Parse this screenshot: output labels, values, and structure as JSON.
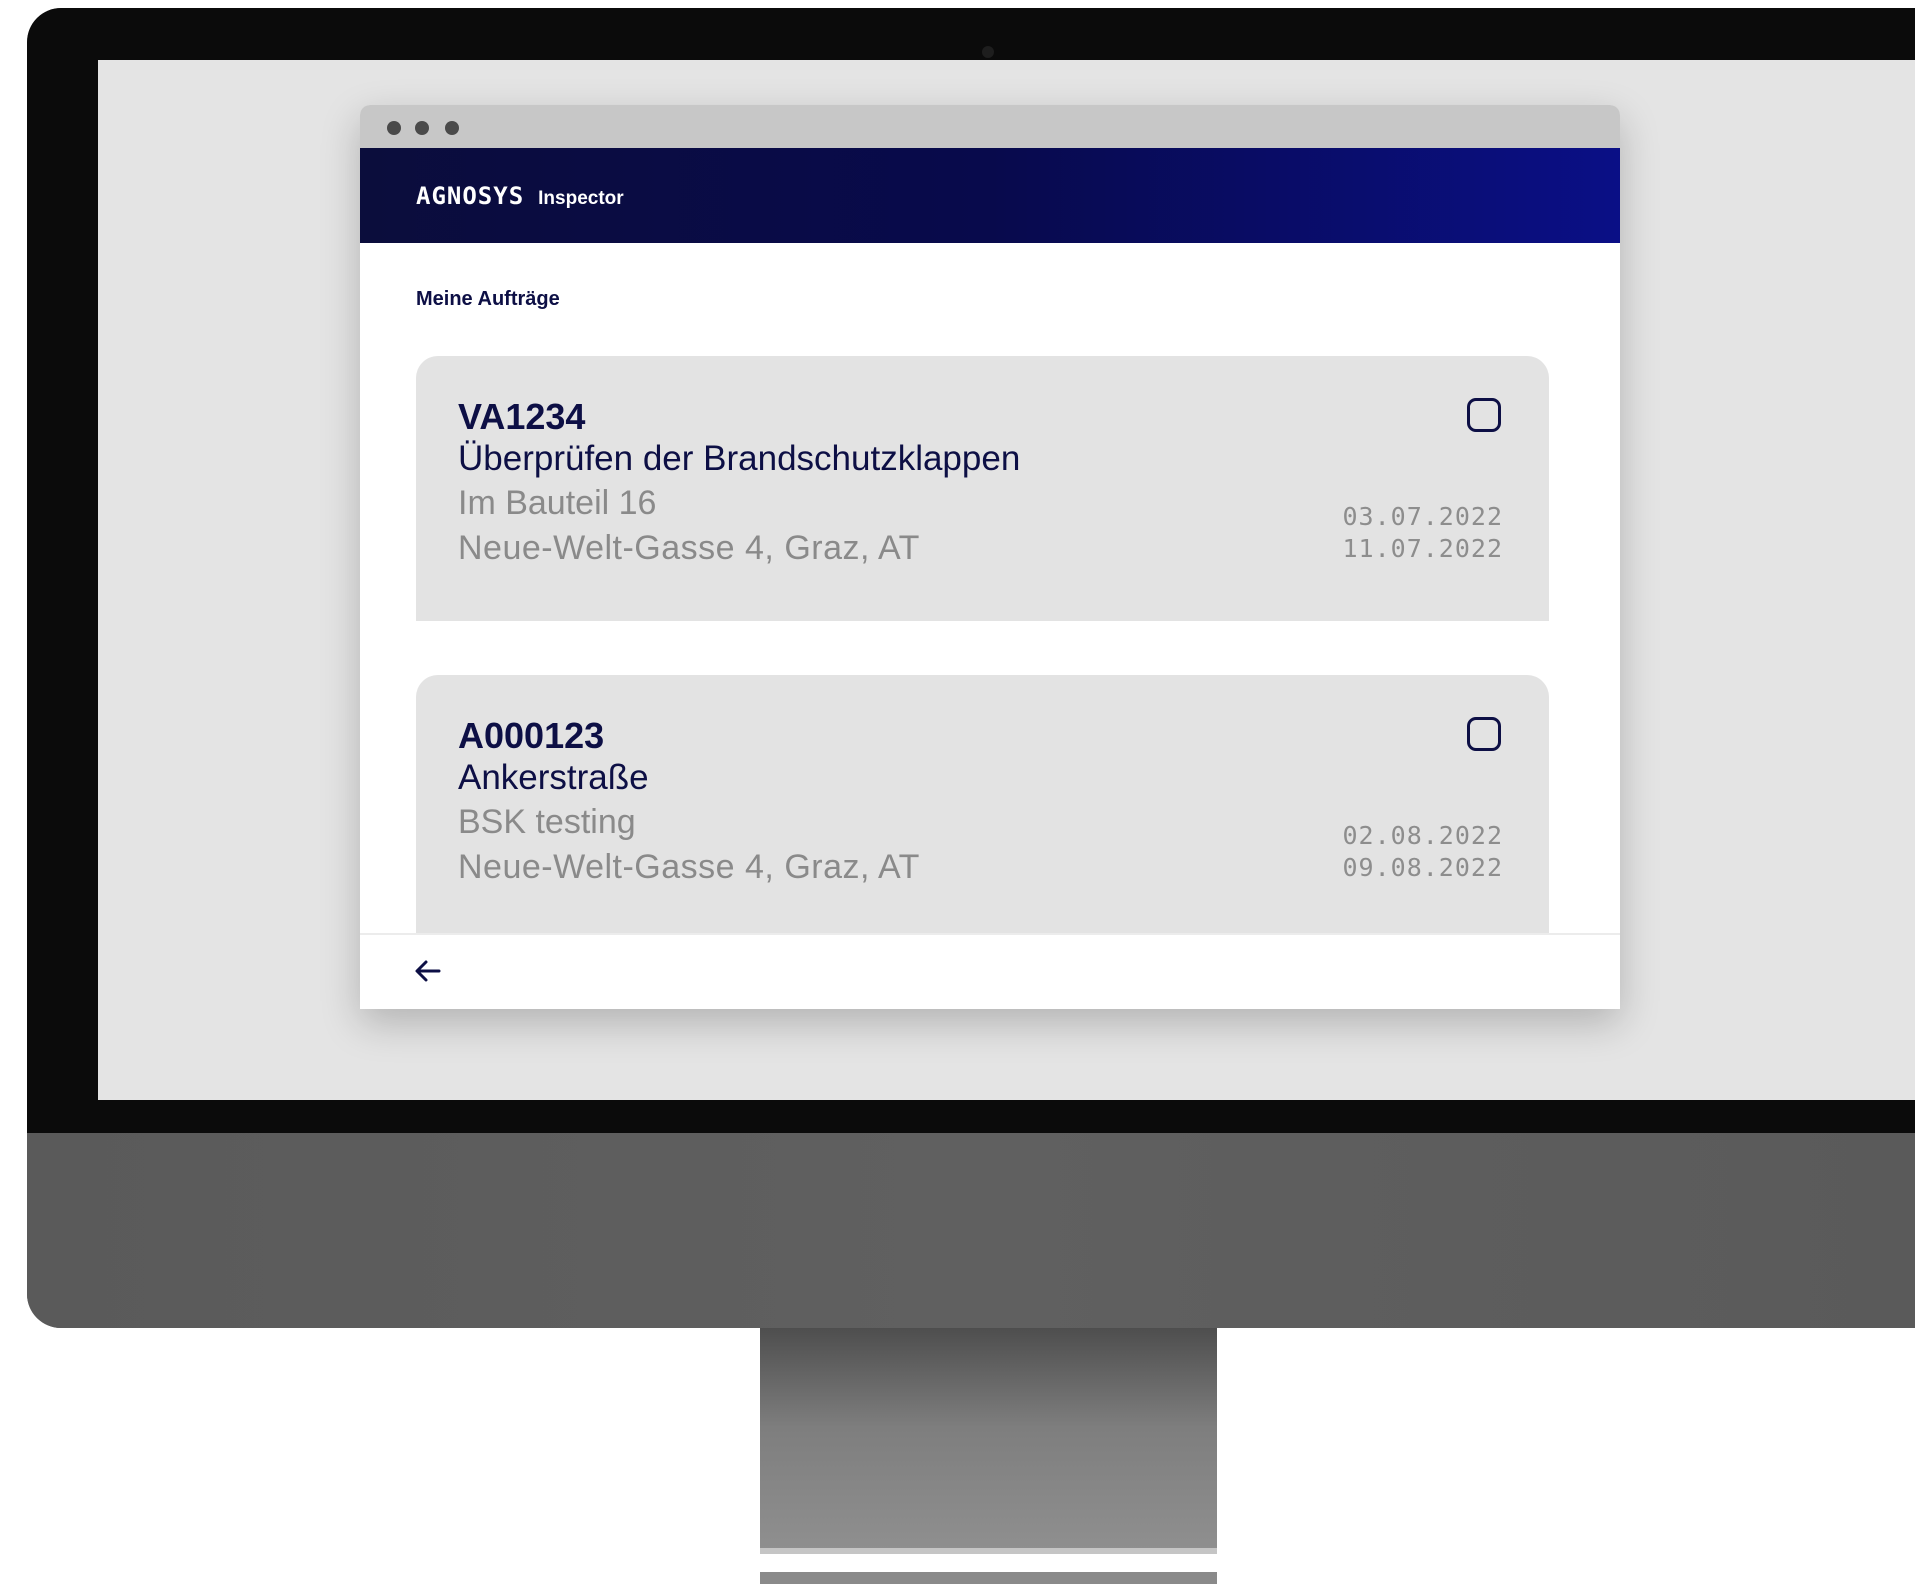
{
  "app": {
    "brand": "AGNOSYS",
    "product": "Inspector"
  },
  "main": {
    "section_title": "Meine Aufträge",
    "orders": [
      {
        "id": "VA1234",
        "title": "Überprüfen der Brandschutzklappen",
        "subtitle": "Im Bauteil 16",
        "address": "Neue-Welt-Gasse 4, Graz, AT",
        "start_date": "03.07.2022",
        "end_date": "11.07.2022"
      },
      {
        "id": "A000123",
        "title": "Ankerstraße",
        "subtitle": "BSK testing",
        "address": "Neue-Welt-Gasse 4, Graz, AT",
        "start_date": "02.08.2022",
        "end_date": "09.08.2022"
      }
    ]
  },
  "footer": {
    "back_icon": "arrow-left-icon"
  },
  "colors": {
    "header_start": "#0b0d3c",
    "header_end": "#0a0f86",
    "primary_text": "#0d0f45",
    "secondary_text": "#8a8a8a",
    "card_bg": "#e3e3e3"
  }
}
